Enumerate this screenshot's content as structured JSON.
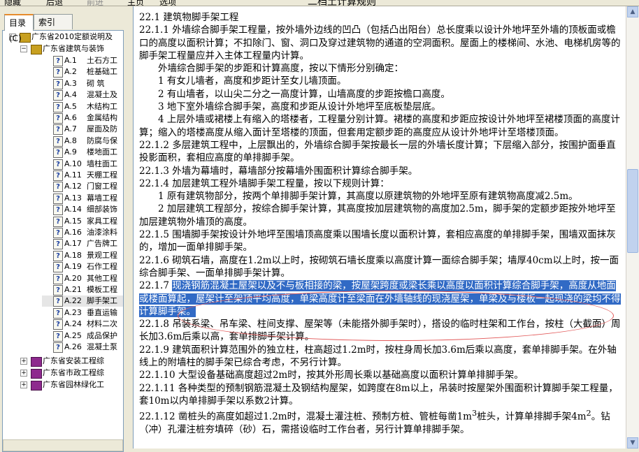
{
  "toolbar": {
    "buttons": [
      "隐藏",
      "后退",
      "前进",
      "主页",
      "选项"
    ],
    "title": "二档土计算规则"
  },
  "tabs": [
    "目录(C)",
    "索引(N)"
  ],
  "tree": {
    "root": "广东省2010定额说明及",
    "sub": "广东省建筑与装饰",
    "items": [
      {
        "code": "A.1",
        "title": "土石方工"
      },
      {
        "code": "A.2",
        "title": "桩基础工"
      },
      {
        "code": "A.3",
        "title": "砌  筑"
      },
      {
        "code": "A.4",
        "title": "混凝土及"
      },
      {
        "code": "A.5",
        "title": "木结构工"
      },
      {
        "code": "A.6",
        "title": "金属结构"
      },
      {
        "code": "A.7",
        "title": "屋面及防"
      },
      {
        "code": "A.8",
        "title": "防腐与保"
      },
      {
        "code": "A.9",
        "title": "楼地面工"
      },
      {
        "code": "A.10",
        "title": "墙柱面工"
      },
      {
        "code": "A.11",
        "title": "天棚工程"
      },
      {
        "code": "A.12",
        "title": "门窗工程"
      },
      {
        "code": "A.13",
        "title": "幕墙工程"
      },
      {
        "code": "A.14",
        "title": "细部装饰"
      },
      {
        "code": "A.15",
        "title": "家具工程"
      },
      {
        "code": "A.16",
        "title": "油漆涂料"
      },
      {
        "code": "A.17",
        "title": "广告牌工"
      },
      {
        "code": "A.18",
        "title": "景观工程"
      },
      {
        "code": "A.19",
        "title": "石作工程"
      },
      {
        "code": "A.20",
        "title": "其他工程"
      },
      {
        "code": "A.21",
        "title": "模板工程"
      },
      {
        "code": "A.22",
        "title": "脚手架工"
      },
      {
        "code": "A.23",
        "title": "垂直运输"
      },
      {
        "code": "A.24",
        "title": "材料二次"
      },
      {
        "code": "A.25",
        "title": "成品保护"
      },
      {
        "code": "A.26",
        "title": "混凝土泵"
      }
    ],
    "books": [
      "广东省安装工程综",
      "广东省市政工程综",
      "广东省园林绿化工"
    ]
  },
  "doc": {
    "heading": "22.1  建筑物脚手架工程",
    "p1": "22.1.1  外墙综合脚手架工程量，按外墙外边线的凹凸（包括凸出阳台）总长度乘以设计外地坪至外墙的顶板面或檐口的高度以面积计算；不扣除门、窗、洞口及穿过建筑物的通道的空洞面积。屋面上的楼梯间、水池、电梯机房等的脚手架工程量应并入主体工程量内计算。",
    "p2": "外墙综合脚手架的步距和计算高度，按以下情形分别确定：",
    "p3": "1  有女儿墙者，高度和步距计至女儿墙顶面。",
    "p4": "2  有山墙者，以山尖二分之一高度计算，山墙高度的步距按檐口高度。",
    "p5": "3  地下室外墙综合脚手架，高度和步距从设计外地坪至底板垫层底。",
    "p6": "4  上层外墙或裙楼上有缩入的塔楼者，工程量分别计算。裙楼的高度和步距应按设计外地坪至裙楼顶面的高度计算；缩入的塔楼高度从缩入面计至塔楼的顶面，但套用定额步距的高度应从设计外地坪计至塔楼顶面。",
    "p7": "22.1.2  多层建筑工程中，上层飘出的，外墙综合脚手架按最长一层的外墙长度计算；下层缩入部分，按围护面垂直投影面积，套相应高度的单排脚手架。",
    "p8": "22.1.3  外墙为幕墙时，幕墙部分按幕墙外围面积计算综合脚手架。",
    "p9": "22.1.4  加层建筑工程外墙脚手架工程量，按以下规则计算：",
    "p10": "1  原有建筑物部分，按两个单排脚手架计算，其高度以原建筑物的外地坪至原有建筑物高度减2.5m。",
    "p11": "2  加层建筑工程部分，按综合脚手架计算，其高度按加层建筑物的高度加2.5m，脚手架的定额步距按外地坪至加层建筑物外墙顶的高度。",
    "p12": "22.1.5  围墙脚手架按设计外地坪至围墙顶高度乘以围墙长度以面积计算，套相应高度的单排脚手架，围墙双面抹灰的，增加一面单排脚手架。",
    "p13": "22.1.6  砌筑石墙，高度在1.2m以上时，按砌筑石墙长度乘以高度计算一面综合脚手架；墙厚40cm以上时，按一面综合脚手架、一面单排脚手架计算。",
    "p14_prefix": "22.1.7  ",
    "p14_hl": "现浇钢筋混凝土屋架以及不与板相接的梁，按屋架跨度或梁长乘以高度以面积计算综合脚手架，高度从地面或楼面算起，屋架计至架顶平均高度，单梁高度计至梁面在外墙轴线的现浇屋架，单梁及与楼板一起现浇的梁均不得计算脚手架。",
    "p15": "22.1.8  吊装系梁、吊车梁、柱间支撑、屋架等（未能搭外脚手架时），搭设的临时柱架和工作台，按柱（大截面）周长加3.6m后乘以高，套单排脚手架计算。",
    "p16": "22.1.9  建筑面积计算范围外的独立柱，柱高超过1.2m时，按柱身周长加3.6m后乘以高度，套单排脚手架。在外轴线上的附墙柱的脚手架已综合考虑，不另行计算。",
    "p17": "22.1.10  大型设备基础高度超过2m时，按其外形周长乘以基础高度以面积计算单排脚手架。",
    "p18": "22.1.11  各种类型的预制钢筋混凝土及钢结构屋架，如跨度在8m以上，吊装时按屋架外围面积计算脚手架工程量，套10m以内单排脚手架以系数2计算。",
    "p19_pre": "22.1.12  凿桩头的高度如超过1.2m时，混凝土灌注桩、预制方桩、管桩每凿1m",
    "p19_sup": "3",
    "p19_post": "桩头，计算单排脚手架4m",
    "p19_sup2": "2",
    "p19_tail": "。钻（冲）孔灌注桩夯填碎（砂）石，需搭设临时工作台者，另行计算单排脚手架。"
  }
}
